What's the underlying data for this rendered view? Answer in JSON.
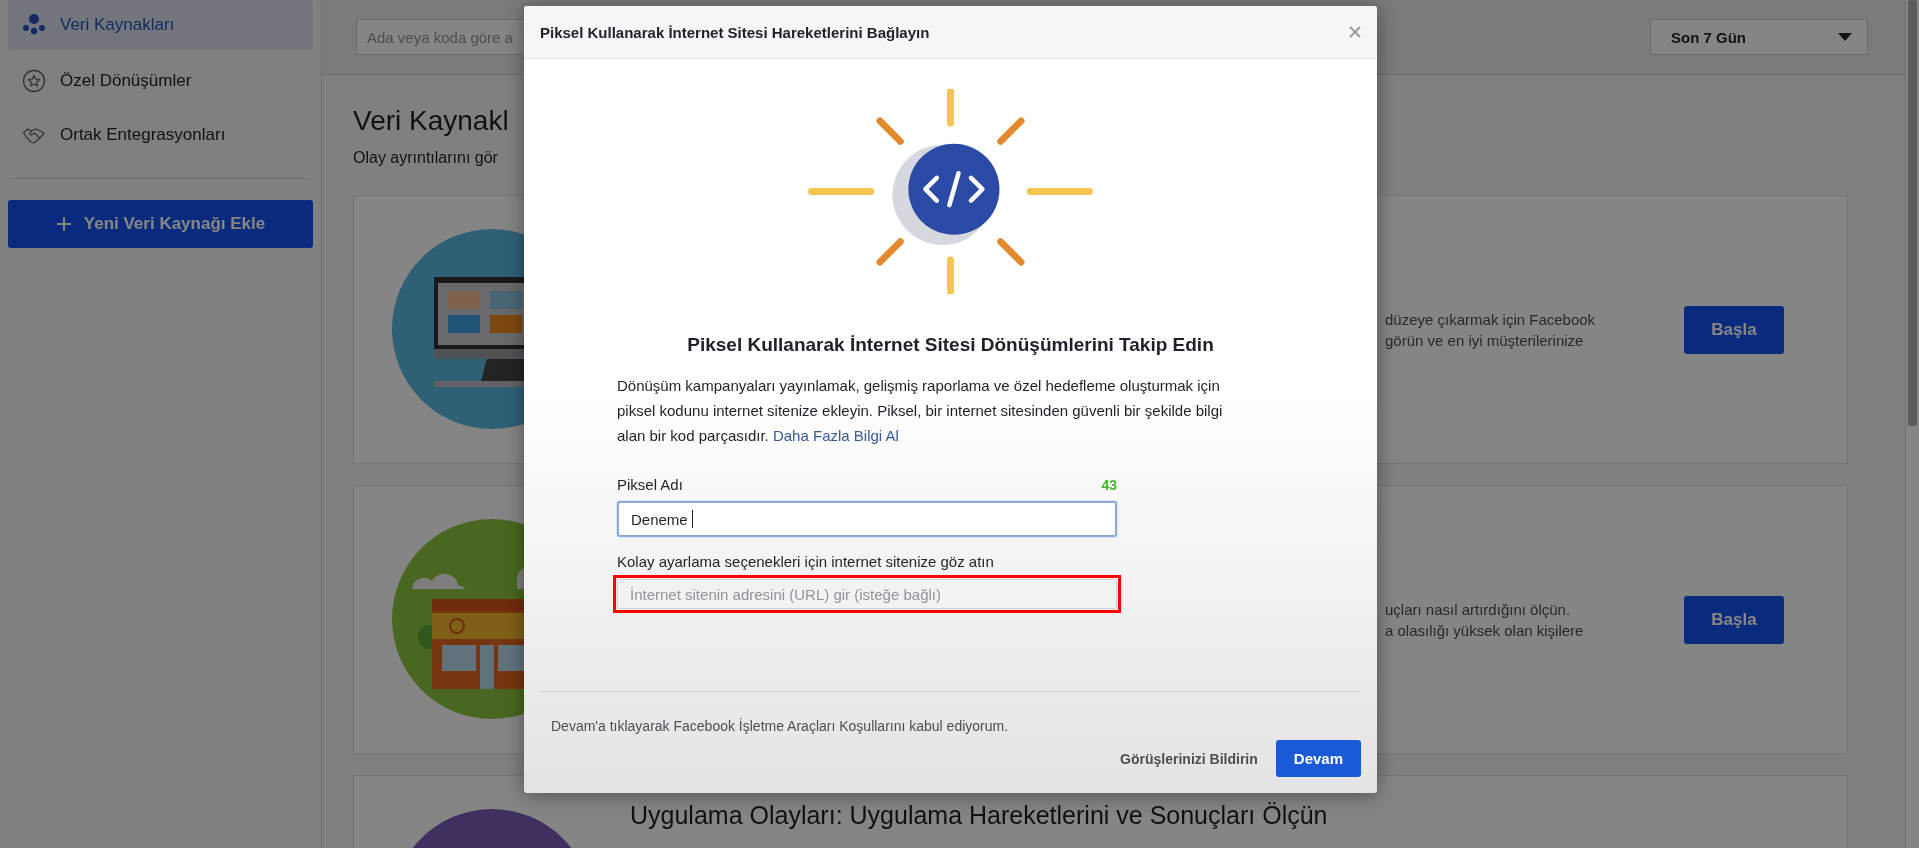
{
  "sidebar": {
    "items": [
      {
        "label": "Veri Kaynakları",
        "kind": "sources",
        "selected": true
      },
      {
        "label": "Özel Dönüşümler",
        "kind": "star",
        "selected": false
      },
      {
        "label": "Ortak Entegrasyonları",
        "kind": "handshake",
        "selected": false
      }
    ],
    "add_button": "Yeni Veri Kaynağı Ekle"
  },
  "toolbar": {
    "search": {
      "placeholder": "Ada veya koda göre a"
    },
    "date_range": "Son 7 Gün"
  },
  "page": {
    "title": "Veri Kaynakl",
    "subtitle": "Olay ayrıntılarını gör"
  },
  "cards": [
    {
      "kind": "website",
      "lines": [
        "düzeye çıkarmak için Facebook",
        "görün ve en iyi müşterilerinize"
      ],
      "button": "Başla"
    },
    {
      "kind": "store",
      "lines": [
        "uçları nasıl artırdığını ölçün.",
        "a olasılığı yüksek olan kişilere"
      ],
      "button": "Başla"
    },
    {
      "kind": "app",
      "title": "Uygulama Olayları: Uygulama Hareketlerini ve Sonuçları Ölçün"
    }
  ],
  "dialog": {
    "title": "Piksel Kullanarak İnternet Sitesi Hareketlerini Bağlayın",
    "heading": "Piksel Kullanarak İnternet Sitesi Dönüşümlerini Takip Edin",
    "description": "Dönüşüm kampanyaları yayınlamak, gelişmiş raporlama ve özel hedefleme oluşturmak için piksel kodunu internet sitenize ekleyin. Piksel, bir internet sitesinden güvenli bir şekilde bilgi alan bir kod parçasıdır.",
    "link": "Daha Fazla Bilgi Al",
    "fields": [
      {
        "label": "Piksel Adı",
        "counter": "43",
        "value": "Deneme",
        "focused": true,
        "highlighted": false
      },
      {
        "label": "Kolay ayarlama seçenekleri için internet sitenize göz atın",
        "placeholder": "İnternet sitenin adresini (URL) gir (isteğe bağlı)",
        "focused": false,
        "highlighted": true
      }
    ],
    "terms": "Devam'a tıklayarak Facebook İşletme Araçları Koşullarını kabul ediyorum.",
    "buttons": [
      {
        "label": "Görüşlerinizi Bildirin",
        "kind": "link"
      },
      {
        "label": "Devam",
        "kind": "primary"
      }
    ]
  }
}
